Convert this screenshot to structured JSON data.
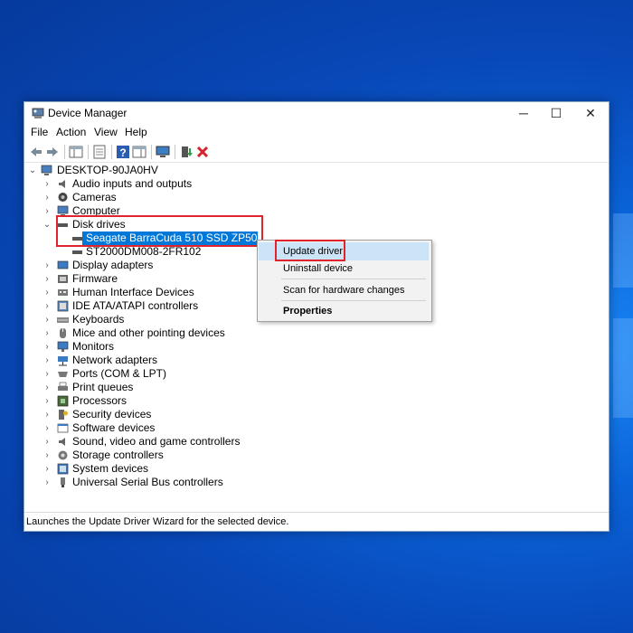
{
  "window": {
    "title": "Device Manager",
    "minimize": "─",
    "maximize": "☐",
    "close": "✕"
  },
  "menubar": [
    "File",
    "Action",
    "View",
    "Help"
  ],
  "toolbar": {
    "icons": [
      "back-arrow-icon",
      "forward-arrow-icon",
      "show-hide-console-tree-icon",
      "properties-icon",
      "help-icon",
      "action-pane-icon",
      "monitor-scan-icon",
      "add-driver-icon",
      "uninstall-x-icon"
    ]
  },
  "tree": {
    "root": "DESKTOP-90JA0HV",
    "categories": [
      {
        "label": "Audio inputs and outputs",
        "icon": "speaker-icon"
      },
      {
        "label": "Cameras",
        "icon": "camera-icon"
      },
      {
        "label": "Computer",
        "icon": "computer-icon"
      },
      {
        "label": "Disk drives",
        "icon": "disk-drive-icon",
        "expanded": true,
        "children": [
          "Seagate BarraCuda 510 SSD ZP500CM30001",
          "ST2000DM008-2FR102"
        ]
      },
      {
        "label": "Display adapters",
        "icon": "display-adapter-icon"
      },
      {
        "label": "Firmware",
        "icon": "firmware-icon"
      },
      {
        "label": "Human Interface Devices",
        "icon": "hid-icon"
      },
      {
        "label": "IDE ATA/ATAPI controllers",
        "icon": "ide-controller-icon"
      },
      {
        "label": "Keyboards",
        "icon": "keyboard-icon"
      },
      {
        "label": "Mice and other pointing devices",
        "icon": "mouse-icon"
      },
      {
        "label": "Monitors",
        "icon": "monitor-icon"
      },
      {
        "label": "Network adapters",
        "icon": "network-adapter-icon"
      },
      {
        "label": "Ports (COM & LPT)",
        "icon": "ports-icon"
      },
      {
        "label": "Print queues",
        "icon": "printer-icon"
      },
      {
        "label": "Processors",
        "icon": "processor-icon"
      },
      {
        "label": "Security devices",
        "icon": "security-device-icon"
      },
      {
        "label": "Software devices",
        "icon": "software-device-icon"
      },
      {
        "label": "Sound, video and game controllers",
        "icon": "sound-controller-icon"
      },
      {
        "label": "Storage controllers",
        "icon": "storage-controller-icon"
      },
      {
        "label": "System devices",
        "icon": "system-device-icon"
      },
      {
        "label": "Universal Serial Bus controllers",
        "icon": "usb-icon"
      }
    ]
  },
  "context_menu": {
    "items": [
      "Update driver",
      "Uninstall device",
      "Scan for hardware changes",
      "Properties"
    ],
    "highlighted": "Update driver"
  },
  "status_bar": "Launches the Update Driver Wizard for the selected device.",
  "colors": {
    "selection": "#0078d7",
    "highlight_box": "#e0232c",
    "desktop": "#0a63d8"
  }
}
